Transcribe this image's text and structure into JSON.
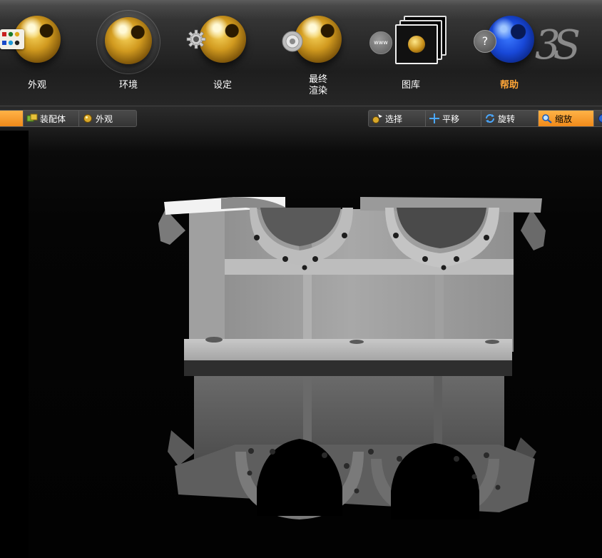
{
  "ribbon": {
    "tools": [
      {
        "id": "appearance",
        "label": "外观",
        "icon": "gold-ball-appearance-icon"
      },
      {
        "id": "environment",
        "label": "环境",
        "icon": "gold-ball-environment-icon"
      },
      {
        "id": "settings",
        "label": "设定",
        "icon": "gold-ball-gear-icon"
      },
      {
        "id": "final-render",
        "label": "最终\n渲染",
        "icon": "gold-ball-render-icon"
      },
      {
        "id": "gallery",
        "label": "图库",
        "icon": "gallery-stack-icon"
      },
      {
        "id": "help",
        "label": "帮助",
        "icon": "blue-ball-help-icon"
      }
    ],
    "badges": {
      "gallery": "www",
      "help": "?"
    },
    "logo_text": "3S",
    "active_color": "#ffa637"
  },
  "strip": {
    "left_tabs": [
      {
        "label": "",
        "active": true
      },
      {
        "label": "装配体",
        "icon": "assembly-icon"
      },
      {
        "label": "外观",
        "icon": "gold-dot-icon"
      }
    ],
    "right_tabs": [
      {
        "label": "选择",
        "icon": "select-icon"
      },
      {
        "label": "平移",
        "icon": "pan-icon"
      },
      {
        "label": "旋转",
        "icon": "rotate-icon"
      },
      {
        "label": "缩放",
        "icon": "zoom-icon",
        "active": true
      }
    ],
    "highlight_color": "#f08a1a"
  }
}
